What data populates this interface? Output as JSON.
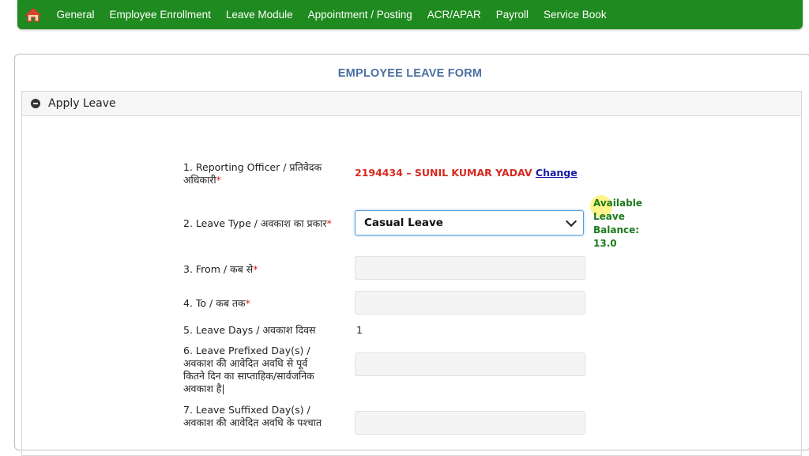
{
  "nav": {
    "home_icon": "home-icon",
    "items": [
      "General",
      "Employee Enrollment",
      "Leave Module",
      "Appointment / Posting",
      "ACR/APAR",
      "Payroll",
      "Service Book"
    ]
  },
  "form": {
    "title": "EMPLOYEE LEAVE FORM",
    "section_label": "Apply Leave",
    "fields": {
      "reporting_officer": {
        "label_1": "1. Reporting Officer / प्रतिवेदक",
        "label_2": "अधिकारी",
        "value": "2194434 – SUNIL KUMAR YADAV",
        "link": "Change"
      },
      "leave_type": {
        "label": "2. Leave Type / अवकाश का प्रकार",
        "value": "Casual Leave",
        "balance_1": "Available",
        "balance_2": "Leave",
        "balance_3": "Balance:",
        "balance_4": "13.0"
      },
      "from": {
        "label": "3. From / कब से",
        "value": ""
      },
      "to": {
        "label": "4. To / कब तक",
        "value": ""
      },
      "leave_days": {
        "label": "5. Leave Days / अवकाश दिवस",
        "value": "1"
      },
      "prefixed": {
        "label_1": "6. Leave Prefixed Day(s) /",
        "label_2": "अवकाश की आवेदित अवधि से पूर्व",
        "label_3": "कितने दिन का साप्ताहिक/सार्वजनिक",
        "label_4": "अवकाश है|"
      },
      "suffixed": {
        "label_1": "7. Leave Suffixed Day(s) /",
        "label_2": "अवकाश की आवेदित अवधि के पश्चात"
      }
    },
    "required_mark": "*"
  }
}
